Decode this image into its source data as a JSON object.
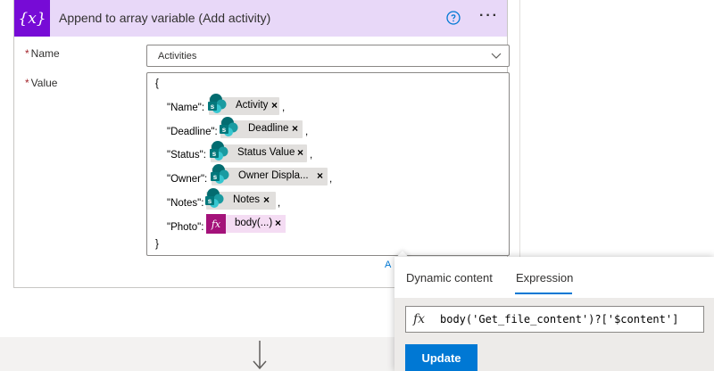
{
  "card": {
    "title": "Append to array variable (Add activity)",
    "icon_text": "{x}",
    "help_icon": "help-circle-icon",
    "more_icon": "ellipsis-icon",
    "more_label": "···",
    "accent_color": "#770bd6"
  },
  "fields": {
    "name_required_mark": "*",
    "name_label": "Name",
    "name_value": "Activities",
    "value_required_mark": "*",
    "value_label": "Value"
  },
  "value_json": {
    "open_brace": "{",
    "close_brace": "}",
    "rows": [
      {
        "key": "\"Name\":",
        "token": "Activity",
        "remove": "×",
        "trailing": ","
      },
      {
        "key": "\"Deadline\":",
        "token": "Deadline",
        "remove": "×",
        "trailing": ","
      },
      {
        "key": "\"Status\":",
        "token": "Status Value",
        "remove": "×",
        "trailing": ","
      },
      {
        "key": "\"Owner\":",
        "token": "Owner Displa...",
        "remove": "×",
        "trailing": ","
      },
      {
        "key": "\"Notes\":",
        "token": "Notes",
        "remove": "×",
        "trailing": ","
      },
      {
        "key": "\"Photo\":",
        "token": "body(...)",
        "remove": "×",
        "fx_label": "fx"
      }
    ]
  },
  "partial_link": "A",
  "popup": {
    "tabs": [
      "Dynamic content",
      "Expression"
    ],
    "active_tab": "Expression",
    "fx_label": "fx",
    "expression": "body('Get_file_content')?['$content']",
    "update_label": "Update",
    "accent_color": "#0078d4"
  },
  "flow_arrow_icon": "down-arrow-icon"
}
